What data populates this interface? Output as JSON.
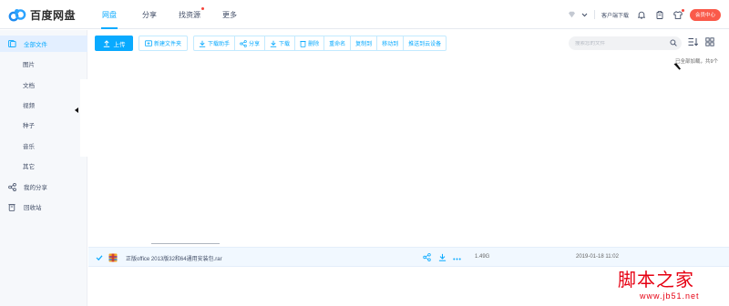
{
  "app": {
    "logo_text": "百度网盘"
  },
  "nav": {
    "tabs": [
      {
        "label": "网盘"
      },
      {
        "label": "分享"
      },
      {
        "label": "找资源"
      },
      {
        "label": "更多"
      }
    ]
  },
  "header_right": {
    "client_download": "客户端下载",
    "vip_label": "会员中心"
  },
  "sidebar": {
    "items": [
      {
        "label": "全部文件"
      },
      {
        "label": "图片"
      },
      {
        "label": "文档"
      },
      {
        "label": "视频"
      },
      {
        "label": "种子"
      },
      {
        "label": "音乐"
      },
      {
        "label": "其它"
      },
      {
        "label": "我的分享"
      },
      {
        "label": "回收站"
      }
    ]
  },
  "toolbar": {
    "upload": "上传",
    "new_folder": "新建文件夹",
    "download_helper": "下载助手",
    "share": "分享",
    "download": "下载",
    "delete": "删除",
    "rename": "重命名",
    "copy_to": "复制到",
    "move_to": "移动到",
    "push_cloud": "推送到云设备"
  },
  "search": {
    "placeholder": "搜索您的文件"
  },
  "status": {
    "loaded_text": "已全部加载，共9个"
  },
  "file_row": {
    "name": "正版office 2013版32和64通用安装包.rar",
    "size": "1.49G",
    "date": "2019-01-18 11:02",
    "checked": true
  },
  "colors": {
    "accent": "#09aaff",
    "vip": "#fa5a4a",
    "watermark": "#e60012"
  },
  "watermark": {
    "title": "脚本之家",
    "url": "www.jb51.net"
  }
}
